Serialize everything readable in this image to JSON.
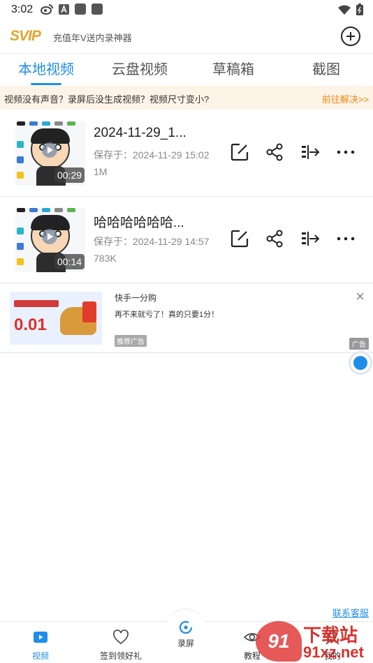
{
  "status_bar": {
    "time": "3:02"
  },
  "header": {
    "logo_text": "SVIP",
    "promo_text": "充值年V送内录神器"
  },
  "tabs": [
    {
      "label": "本地视频",
      "active": true
    },
    {
      "label": "云盘视频",
      "active": false
    },
    {
      "label": "草稿箱",
      "active": false
    },
    {
      "label": "截图",
      "active": false
    }
  ],
  "notice": {
    "text": "视频没有声音？录屏后没生成视频？视频尺寸变小?",
    "link": "前往解决>>"
  },
  "videos": [
    {
      "title": "2024-11-29_1...",
      "saved_at": "保存于：2024-11-29 15:02",
      "size": "1M",
      "duration": "00:29"
    },
    {
      "title": "哈哈哈哈哈哈...",
      "saved_at": "保存于：2024-11-29 14:57",
      "size": "783K",
      "duration": "00:14"
    }
  ],
  "ad": {
    "title": "快手一分购",
    "description": "再不来就亏了！真的只要1分！",
    "tag": "推荐广告",
    "badge": "广告",
    "price": "0.01",
    "close": "×"
  },
  "contact_link": "联系客服",
  "bottom_nav": [
    {
      "label": "视频",
      "icon": "video-icon",
      "active": true
    },
    {
      "label": "签到领好礼",
      "icon": "gift-heart-icon",
      "active": false
    },
    {
      "label": "录屏",
      "icon": "record-icon",
      "active": false
    },
    {
      "label": "教程",
      "icon": "eye-icon",
      "active": false
    },
    {
      "label": "我的",
      "icon": "user-icon",
      "active": false
    }
  ],
  "watermark": {
    "badge": "91",
    "title": "下载站",
    "url": "91xz.net"
  },
  "colors": {
    "accent": "#1e8ee8",
    "logo": "#e6a42a",
    "notice_bg": "#fdf3e6",
    "notice_link": "#ef8a18"
  }
}
